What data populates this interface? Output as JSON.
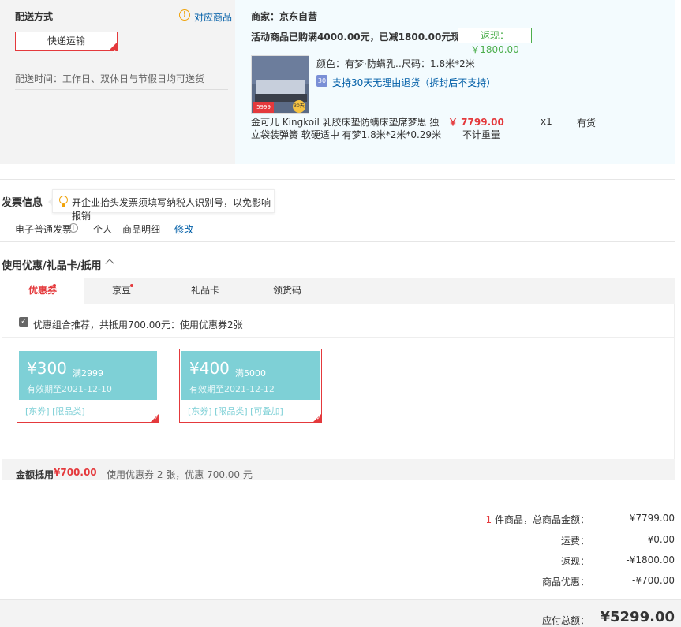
{
  "delivery": {
    "title": "配送方式",
    "match_link": "对应商品",
    "method": "快递运输",
    "time": "配送时间：工作日、双休日与节假日均可送货"
  },
  "shop": {
    "merchant": "商家：京东自营",
    "promo": "活动商品已购满4000.00元，已减1800.00元现金",
    "rebate": "返现：￥1800.00",
    "color": "颜色：有梦·防螨乳…",
    "size": "尺码：1.8米*2米",
    "return_icon_text": "30",
    "return_policy": "支持30天无理由退货（拆封后不支持）",
    "product_name_line1": "金可儿 Kingkoil 乳胶床垫防螨床垫席梦思 独",
    "product_name_line2": "立袋装弹簧 软硬适中 有梦1.8米*2米*0.29米",
    "price": "￥ 7799.00",
    "weight": "不计重量",
    "qty": "x1",
    "stock": "有货",
    "img_price": "5999",
    "img_badge": "30天"
  },
  "invoice": {
    "title": "发票信息",
    "tip": "开企业抬头发票须填写纳税人识别号，以免影响报销",
    "type": "电子普通发票",
    "holder": "个人",
    "content": "商品明细",
    "edit": "修改"
  },
  "coupons": {
    "title": "使用优惠/礼品卡/抵用",
    "tabs": [
      "优惠券",
      "京豆",
      "礼品卡",
      "领货码"
    ],
    "recommend": "优惠组合推荐，共抵用700.00元：使用优惠券2张",
    "items": [
      {
        "amount": "¥300",
        "cond": "满2999",
        "valid": "有效期至2021-12-10",
        "tags": "[东券]  [限品类]"
      },
      {
        "amount": "¥400",
        "cond": "满5000",
        "valid": "有效期至2021-12-12",
        "tags": "[东券]  [限品类]  [可叠加]"
      }
    ],
    "discount_label": "金额抵用",
    "discount_value": "¥700.00",
    "discount_desc": "使用优惠券 2 张，优惠 700.00 元"
  },
  "summary": {
    "count": "1",
    "count_suffix": " 件商品，总商品金额：",
    "goods_total": "¥7799.00",
    "shipping_label": "运费：",
    "shipping": "¥0.00",
    "rebate_label": "返现：",
    "rebate": "-¥1800.00",
    "promo_label": "商品优惠：",
    "promo": "-¥700.00",
    "total_label": "应付总额：",
    "total": "¥5299.00"
  },
  "colors": {
    "accent": "#e4393c",
    "link": "#005ea7",
    "coupon": "#7ed0d6",
    "rebate": "#4cae4c"
  }
}
